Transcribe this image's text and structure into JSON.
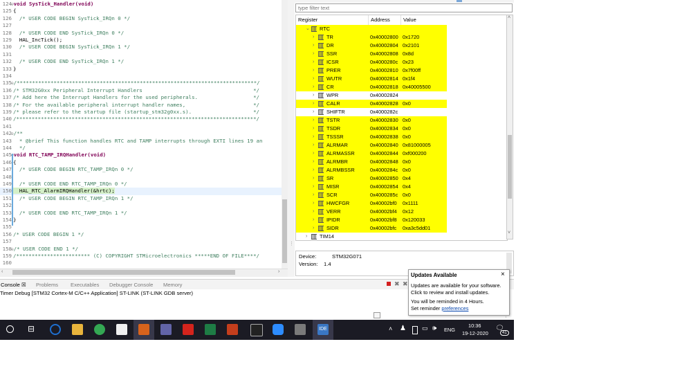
{
  "editor": {
    "lines": [
      {
        "no": "124",
        "fold": "⊖",
        "html": "kw",
        "text": "void SysTick_Handler(void)"
      },
      {
        "no": "125",
        "text": "{"
      },
      {
        "no": "126",
        "text": "  /* USER CODE BEGIN SysTick_IRQn 0 */",
        "cls": "cm"
      },
      {
        "no": "127",
        "text": ""
      },
      {
        "no": "128",
        "text": "  /* USER CODE END SysTick_IRQn 0 */",
        "cls": "cm"
      },
      {
        "no": "129",
        "text": "  HAL_IncTick();"
      },
      {
        "no": "130",
        "text": "  /* USER CODE BEGIN SysTick_IRQn 1 */",
        "cls": "cm"
      },
      {
        "no": "131",
        "text": ""
      },
      {
        "no": "132",
        "text": "  /* USER CODE END SysTick_IRQn 1 */",
        "cls": "cm"
      },
      {
        "no": "133",
        "text": "}"
      },
      {
        "no": "134",
        "text": ""
      },
      {
        "no": "135",
        "fold": "⊖",
        "text": "/******************************************************************************/",
        "cls": "cm"
      },
      {
        "no": "136",
        "text": "/* STM32G0xx Peripheral Interrupt Handlers                                    */",
        "cls": "cm"
      },
      {
        "no": "137",
        "text": "/* Add here the Interrupt Handlers for the used peripherals.                  */",
        "cls": "cm"
      },
      {
        "no": "138",
        "text": "/* For the available peripheral interrupt handler names,                      */",
        "cls": "cm"
      },
      {
        "no": "139",
        "text": "/* please refer to the startup file (startup_stm32g0xx.s).                    */",
        "cls": "cm"
      },
      {
        "no": "140",
        "text": "/******************************************************************************/",
        "cls": "cm"
      },
      {
        "no": "141",
        "text": ""
      },
      {
        "no": "142",
        "fold": "⊖",
        "text": "/**",
        "cls": "cm"
      },
      {
        "no": "143",
        "text": "  * @brief This function handles RTC and TAMP interrupts through EXTI lines 19 an",
        "cls": "cm"
      },
      {
        "no": "144",
        "text": "  */",
        "cls": "cm"
      },
      {
        "no": "145",
        "fold": "⊖",
        "html": "kw",
        "text": "void RTC_TAMP_IRQHandler(void)"
      },
      {
        "no": "146",
        "text": "{"
      },
      {
        "no": "147",
        "text": "  /* USER CODE BEGIN RTC_TAMP_IRQn 0 */",
        "cls": "cm"
      },
      {
        "no": "148",
        "text": ""
      },
      {
        "no": "149",
        "text": "  /* USER CODE END RTC_TAMP_IRQn 0 */",
        "cls": "cm"
      },
      {
        "no": "150",
        "text": "  HAL_RTC_AlarmIRQHandler(&hrtc);",
        "current": true
      },
      {
        "no": "151",
        "text": "  /* USER CODE BEGIN RTC_TAMP_IRQn 1 */",
        "cls": "cm"
      },
      {
        "no": "152",
        "text": ""
      },
      {
        "no": "153",
        "text": "  /* USER CODE END RTC_TAMP_IRQn 1 */",
        "cls": "cm"
      },
      {
        "no": "154",
        "text": "}"
      },
      {
        "no": "155",
        "text": ""
      },
      {
        "no": "156",
        "text": "/* USER CODE BEGIN 1 */",
        "cls": "cm"
      },
      {
        "no": "157",
        "text": ""
      },
      {
        "no": "158",
        "fold": "⊖",
        "text": "/* USER CODE END 1 */",
        "cls": "cm"
      },
      {
        "no": "159",
        "text": "/************************ (C) COPYRIGHT STMicroelectronics *****END OF FILE****/",
        "cls": "cm"
      },
      {
        "no": "160",
        "text": ""
      }
    ]
  },
  "registers": {
    "filter_placeholder": "type filter text",
    "headers": {
      "register": "Register",
      "address": "Address",
      "value": "Value"
    },
    "group": {
      "name": "RTC",
      "toggle": "⌄"
    },
    "rows": [
      {
        "name": "TR",
        "address": "0x40002800",
        "value": "0x1720",
        "hl": true
      },
      {
        "name": "DR",
        "address": "0x40002804",
        "value": "0x2101",
        "hl": true
      },
      {
        "name": "SSR",
        "address": "0x40002808",
        "value": "0x8d",
        "hl": true
      },
      {
        "name": "ICSR",
        "address": "0x4000280c",
        "value": "0x23",
        "hl": true
      },
      {
        "name": "PRER",
        "address": "0x40002810",
        "value": "0x7f00ff",
        "hl": true
      },
      {
        "name": "WUTR",
        "address": "0x40002814",
        "value": "0x1f4",
        "hl": true
      },
      {
        "name": "CR",
        "address": "0x40002818",
        "value": "0x40005500",
        "hl": true
      },
      {
        "name": "WPR",
        "address": "0x40002824",
        "value": "",
        "hl": false
      },
      {
        "name": "CALR",
        "address": "0x40002828",
        "value": "0x0",
        "hl": true
      },
      {
        "name": "SHIFTR",
        "address": "0x4000282c",
        "value": "",
        "hl": false
      },
      {
        "name": "TSTR",
        "address": "0x40002830",
        "value": "0x0",
        "hl": true
      },
      {
        "name": "TSDR",
        "address": "0x40002834",
        "value": "0x0",
        "hl": true
      },
      {
        "name": "TSSSR",
        "address": "0x40002838",
        "value": "0x0",
        "hl": true
      },
      {
        "name": "ALRMAR",
        "address": "0x40002840",
        "value": "0x81000005",
        "hl": true
      },
      {
        "name": "ALRMASSR",
        "address": "0x40002844",
        "value": "0xf000200",
        "hl": true
      },
      {
        "name": "ALRMBR",
        "address": "0x40002848",
        "value": "0x0",
        "hl": true
      },
      {
        "name": "ALRMBSSR",
        "address": "0x4000284c",
        "value": "0x0",
        "hl": true
      },
      {
        "name": "SR",
        "address": "0x40002850",
        "value": "0x4",
        "hl": true
      },
      {
        "name": "MISR",
        "address": "0x40002854",
        "value": "0x4",
        "hl": true
      },
      {
        "name": "SCR",
        "address": "0x4000285c",
        "value": "0x0",
        "hl": true
      },
      {
        "name": "HWCFGR",
        "address": "0x40002bf0",
        "value": "0x1111",
        "hl": true
      },
      {
        "name": "VERR",
        "address": "0x40002bf4",
        "value": "0x12",
        "hl": true
      },
      {
        "name": "IPIDR",
        "address": "0x40002bf8",
        "value": "0x120033",
        "hl": true
      },
      {
        "name": "SIDR",
        "address": "0x40002bfc",
        "value": "0xa3c5dd01",
        "hl": true
      }
    ],
    "next_group": {
      "name": "TIM14"
    }
  },
  "device_info": {
    "device_label": "Device:",
    "device_value": "STM32G071",
    "version_label": "Version:",
    "version_value": "1.4"
  },
  "console": {
    "tabs": [
      "Console ☒",
      "Problems",
      "Executables",
      "Debugger Console",
      "Memory"
    ],
    "session": "Timer Debug [STM32 Cortex-M C/C++ Application] ST-LINK (ST-LINK GDB server)"
  },
  "notification": {
    "title": "Updates Available",
    "close": "×",
    "line1": "Updates are available for your software.",
    "line2": "Click to review and install updates.",
    "line3": "You will be reminded in 4 Hours.",
    "line4_prefix": "Set reminder ",
    "line4_link": "preferences"
  },
  "taskbar": {
    "ide_label": "IDE",
    "lang": "ENG",
    "time": "10:36",
    "date": "19-12-2020",
    "notif_count": "41",
    "colors": {
      "bg": "#1b1b24",
      "edge": "#1e6fd0",
      "files": "#e8b43c",
      "chrome": "#34a853",
      "store": "#f0f0f0",
      "outlook": "#d8631c",
      "teams": "#6264a7",
      "acrobat": "#d4241c",
      "excel": "#1e7c45",
      "ppt": "#c43e1c",
      "zoom": "#2d8cff",
      "ide": "#3a77c4"
    }
  }
}
